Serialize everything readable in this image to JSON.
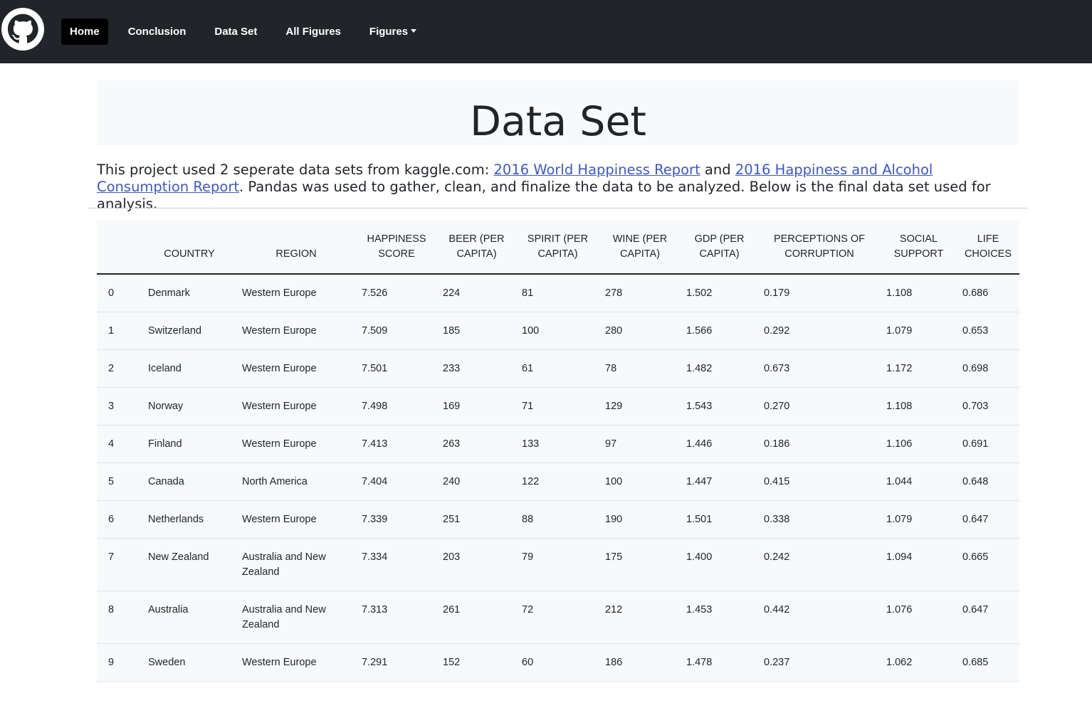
{
  "nav": {
    "brand_icon": "github-icon",
    "items": [
      {
        "label": "Home",
        "active": true
      },
      {
        "label": "Conclusion",
        "active": false
      },
      {
        "label": "Data Set",
        "active": false
      },
      {
        "label": "All Figures",
        "active": false
      }
    ],
    "dropdown_label": "Figures"
  },
  "header": {
    "title": "Data Set"
  },
  "intro": {
    "text_before": "This project used 2 seperate data sets from kaggle.com: ",
    "link1": "2016 World Happiness Report",
    "text_mid": " and ",
    "link2": "2016 Happiness and Alcohol Consumption Report",
    "text_after": ". Pandas was used to gather, clean, and finalize the data to be analyzed. Below is the final data set used for analysis."
  },
  "table": {
    "columns": [
      "",
      "COUNTRY",
      "REGION",
      "HAPPINESS SCORE",
      "BEER (PER CAPITA)",
      "SPIRIT (PER CAPITA)",
      "WINE (PER CAPITA)",
      "GDP (PER CAPITA)",
      "PERCEPTIONS OF CORRUPTION",
      "SOCIAL SUPPORT",
      "LIFE CHOICES"
    ],
    "rows": [
      [
        "0",
        "Denmark",
        "Western Europe",
        "7.526",
        "224",
        "81",
        "278",
        "1.502",
        "0.179",
        "1.108",
        "0.686"
      ],
      [
        "1",
        "Switzerland",
        "Western Europe",
        "7.509",
        "185",
        "100",
        "280",
        "1.566",
        "0.292",
        "1.079",
        "0.653"
      ],
      [
        "2",
        "Iceland",
        "Western Europe",
        "7.501",
        "233",
        "61",
        "78",
        "1.482",
        "0.673",
        "1.172",
        "0.698"
      ],
      [
        "3",
        "Norway",
        "Western Europe",
        "7.498",
        "169",
        "71",
        "129",
        "1.543",
        "0.270",
        "1.108",
        "0.703"
      ],
      [
        "4",
        "Finland",
        "Western Europe",
        "7.413",
        "263",
        "133",
        "97",
        "1.446",
        "0.186",
        "1.106",
        "0.691"
      ],
      [
        "5",
        "Canada",
        "North America",
        "7.404",
        "240",
        "122",
        "100",
        "1.447",
        "0.415",
        "1.044",
        "0.648"
      ],
      [
        "6",
        "Netherlands",
        "Western Europe",
        "7.339",
        "251",
        "88",
        "190",
        "1.501",
        "0.338",
        "1.079",
        "0.647"
      ],
      [
        "7",
        "New Zealand",
        "Australia and New Zealand",
        "7.334",
        "203",
        "79",
        "175",
        "1.400",
        "0.242",
        "1.094",
        "0.665"
      ],
      [
        "8",
        "Australia",
        "Australia and New Zealand",
        "7.313",
        "261",
        "72",
        "212",
        "1.453",
        "0.442",
        "1.076",
        "0.647"
      ],
      [
        "9",
        "Sweden",
        "Western Europe",
        "7.291",
        "152",
        "60",
        "186",
        "1.478",
        "0.237",
        "1.062",
        "0.685"
      ]
    ]
  },
  "colors": {
    "navbar_bg": "#212529",
    "active_nav_bg": "#000000",
    "link": "#3b56d9",
    "panel_bg": "#f8f9fa"
  }
}
